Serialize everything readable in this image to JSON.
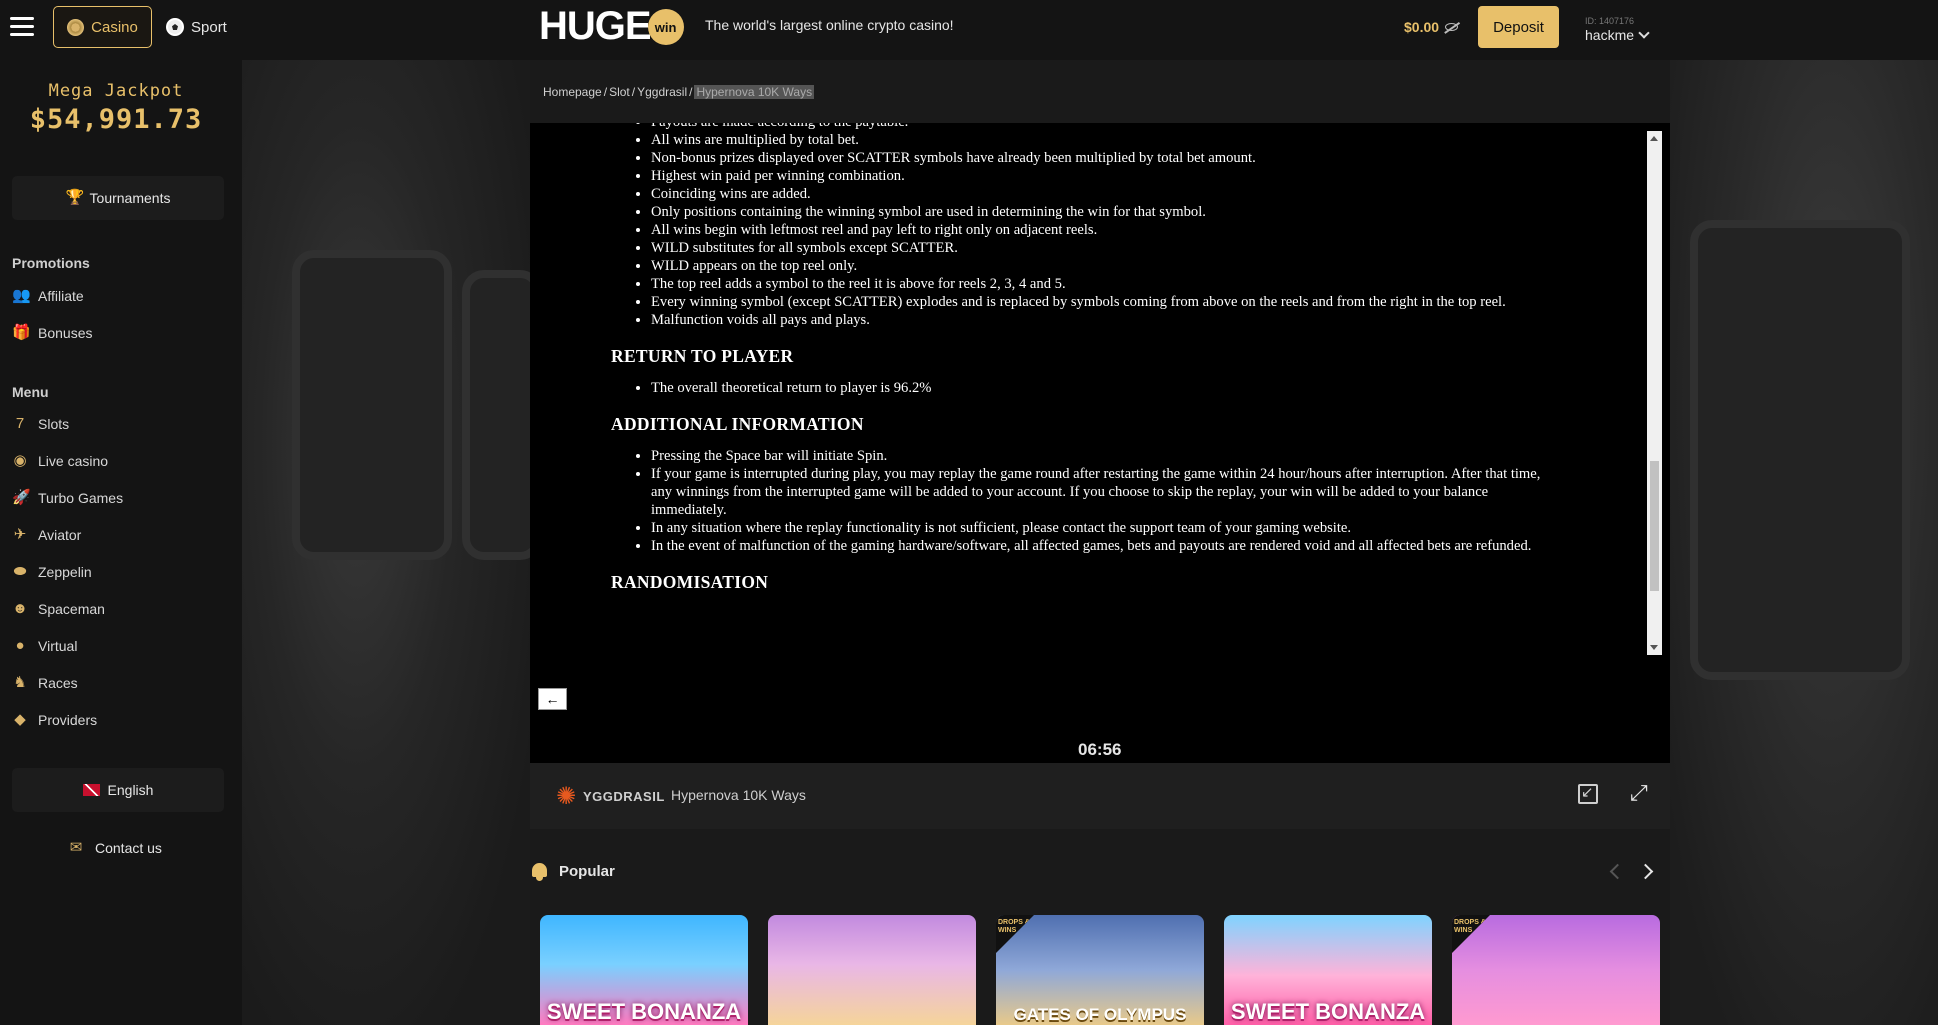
{
  "header": {
    "casino_label": "Casino",
    "sport_label": "Sport",
    "logo_text": "HUGE",
    "logo_badge": "win",
    "tagline": "The world's largest online crypto casino!",
    "balance": "$0.00",
    "deposit_label": "Deposit",
    "user_id": "ID: 1407176",
    "username": "hackme",
    "accent_color": "#e8c06a"
  },
  "sidebar": {
    "jackpot_title": "Mega Jackpot",
    "jackpot_value": "$54,991.73",
    "tournaments_label": "Tournaments",
    "promotions_heading": "Promotions",
    "promotions": [
      {
        "label": "Affiliate",
        "icon": "users-icon"
      },
      {
        "label": "Bonuses",
        "icon": "gift-icon"
      }
    ],
    "menu_heading": "Menu",
    "menu": [
      {
        "label": "Slots",
        "icon": "slot-777-icon"
      },
      {
        "label": "Live casino",
        "icon": "chip-icon"
      },
      {
        "label": "Turbo Games",
        "icon": "rocket-icon"
      },
      {
        "label": "Aviator",
        "icon": "plane-icon"
      },
      {
        "label": "Zeppelin",
        "icon": "zeppelin-icon"
      },
      {
        "label": "Spaceman",
        "icon": "astronaut-icon"
      },
      {
        "label": "Virtual",
        "icon": "ball-icon"
      },
      {
        "label": "Races",
        "icon": "horse-icon"
      },
      {
        "label": "Providers",
        "icon": "diamond-icon"
      }
    ],
    "language_label": "English",
    "contact_label": "Contact us"
  },
  "breadcrumb": {
    "items": [
      "Homepage",
      "Slot",
      "Yggdrasil"
    ],
    "current": "Hypernova 10K Ways"
  },
  "rules": {
    "list1": [
      "Payouts are made according to the paytable.",
      "All wins are multiplied by total bet.",
      "Non-bonus prizes displayed over SCATTER symbols have already been multiplied by total bet amount.",
      "Highest win paid per winning combination.",
      "Coinciding wins are added.",
      "Only positions containing the winning symbol are used in determining the win for that symbol.",
      "All wins begin with leftmost reel and pay left to right only on adjacent reels.",
      "WILD substitutes for all symbols except SCATTER.",
      "WILD appears on the top reel only.",
      "The top reel adds a symbol to the reel it is above for reels 2, 3, 4 and 5.",
      "Every winning symbol (except SCATTER) explodes and is replaced by symbols coming from above on the reels and from the right in the top reel.",
      "Malfunction voids all pays and plays."
    ],
    "rtp_heading": "RETURN TO PLAYER",
    "rtp_list": [
      "The overall theoretical return to player is 96.2%"
    ],
    "info_heading": "ADDITIONAL INFORMATION",
    "info_list": [
      "Pressing the Space bar will initiate Spin.",
      "If your game is interrupted during play, you may replay the game round after restarting the game within 24 hour/hours after interruption. After that time, any winnings from the interrupted game will be added to your account. If you choose to skip the replay, your win will be added to your balance immediately.",
      "In any situation where the replay functionality is not sufficient, please contact the support team of your gaming website.",
      "In the event of malfunction of the gaming hardware/software, all affected games, bets and payouts are rendered void and all affected bets are refunded."
    ],
    "random_heading": "RANDOMISATION"
  },
  "game": {
    "back_label": "←",
    "timer": "06:56",
    "provider": "YGGDRASIL",
    "name": "Hypernova 10K Ways"
  },
  "popular": {
    "title": "Popular",
    "cards": [
      {
        "title": "SWEET BONANZA",
        "badge": ""
      },
      {
        "title": "",
        "badge": ""
      },
      {
        "title": "GATES OF OLYMPUS",
        "badge": "DROPS & WINS"
      },
      {
        "title": "SWEET BONANZA",
        "badge": ""
      },
      {
        "title": "",
        "badge": "DROPS & WINS"
      }
    ]
  }
}
